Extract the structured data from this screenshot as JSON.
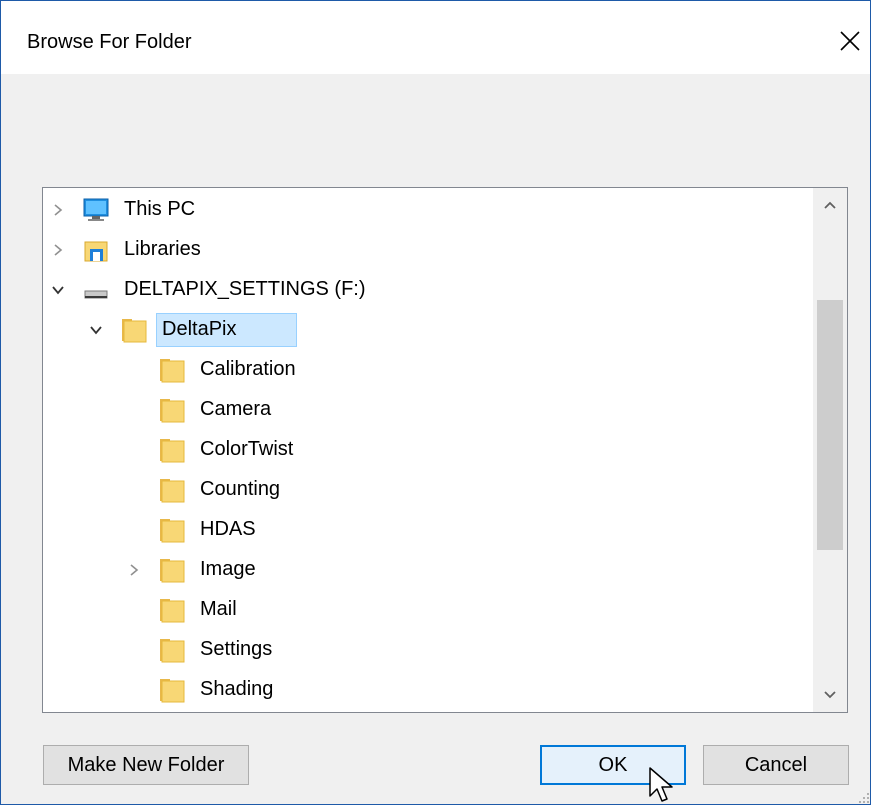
{
  "window": {
    "title": "Browse For Folder",
    "close_glyph": "×"
  },
  "tree": {
    "items": [
      {
        "label": "This PC",
        "icon": "computer-icon",
        "expander": "right"
      },
      {
        "label": "Libraries",
        "icon": "library-icon",
        "expander": "right"
      },
      {
        "label": "DELTAPIX_SETTINGS (F:)",
        "icon": "drive-icon",
        "expander": "down"
      },
      {
        "label": "DeltaPix",
        "icon": "folder-icon",
        "expander": "down",
        "selected": true
      },
      {
        "label": "Calibration",
        "icon": "folder-icon",
        "expander": "none"
      },
      {
        "label": "Camera",
        "icon": "folder-icon",
        "expander": "none"
      },
      {
        "label": "ColorTwist",
        "icon": "folder-icon",
        "expander": "none"
      },
      {
        "label": "Counting",
        "icon": "folder-icon",
        "expander": "none"
      },
      {
        "label": "HDAS",
        "icon": "folder-icon",
        "expander": "none"
      },
      {
        "label": "Image",
        "icon": "folder-icon",
        "expander": "right"
      },
      {
        "label": "Mail",
        "icon": "folder-icon",
        "expander": "none"
      },
      {
        "label": "Settings",
        "icon": "folder-icon",
        "expander": "none"
      },
      {
        "label": "Shading",
        "icon": "folder-icon",
        "expander": "none"
      }
    ]
  },
  "buttons": {
    "make_new_folder": "Make New Folder",
    "ok": "OK",
    "cancel": "Cancel"
  },
  "colors": {
    "selection": "#cce8ff",
    "accent": "#0078d7",
    "folder": "#f8d775"
  }
}
